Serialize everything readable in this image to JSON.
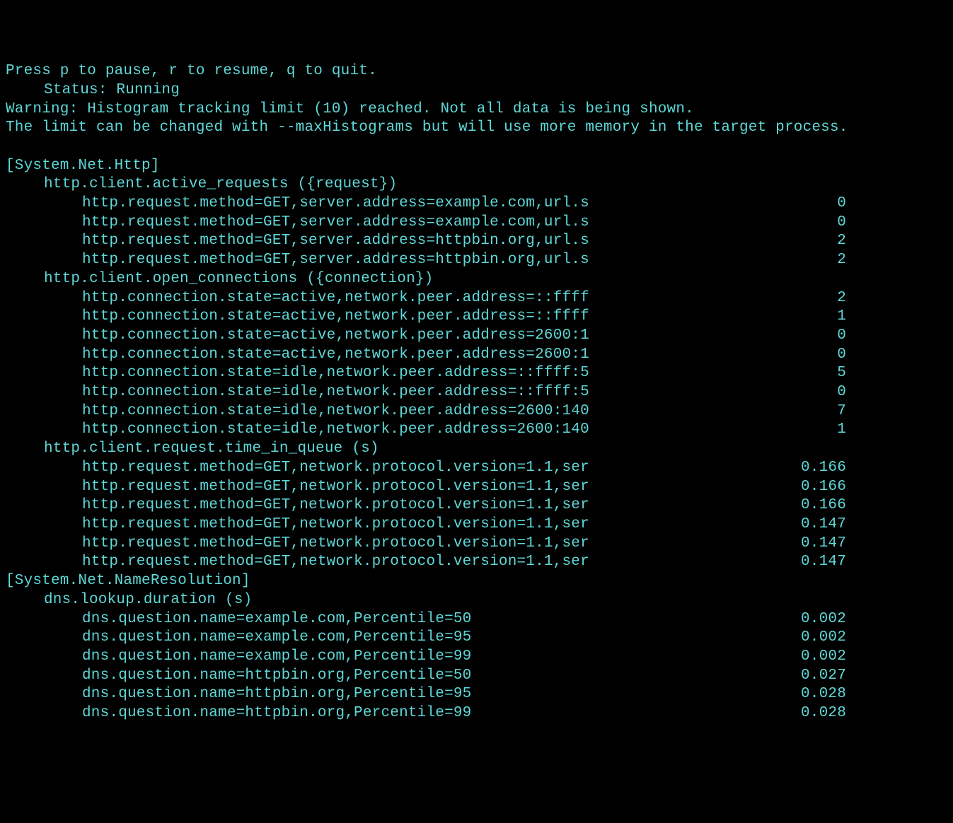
{
  "header": {
    "controls": "Press p to pause, r to resume, q to quit.",
    "status_label": "Status:",
    "status_value": "Running",
    "warning_line1": "Warning: Histogram tracking limit (10) reached. Not all data is being shown.",
    "warning_line2": "The limit can be changed with --maxHistograms but will use more memory in the target process."
  },
  "sections": [
    {
      "name": "[System.Net.Http]",
      "metrics": [
        {
          "title": "http.client.active_requests ({request})",
          "rows": [
            {
              "label": "http.request.method=GET,server.address=example.com,url.s",
              "value": "0"
            },
            {
              "label": "http.request.method=GET,server.address=example.com,url.s",
              "value": "0"
            },
            {
              "label": "http.request.method=GET,server.address=httpbin.org,url.s",
              "value": "2"
            },
            {
              "label": "http.request.method=GET,server.address=httpbin.org,url.s",
              "value": "2"
            }
          ]
        },
        {
          "title": "http.client.open_connections ({connection})",
          "rows": [
            {
              "label": "http.connection.state=active,network.peer.address=::ffff",
              "value": "2"
            },
            {
              "label": "http.connection.state=active,network.peer.address=::ffff",
              "value": "1"
            },
            {
              "label": "http.connection.state=active,network.peer.address=2600:1",
              "value": "0"
            },
            {
              "label": "http.connection.state=active,network.peer.address=2600:1",
              "value": "0"
            },
            {
              "label": "http.connection.state=idle,network.peer.address=::ffff:5",
              "value": "5"
            },
            {
              "label": "http.connection.state=idle,network.peer.address=::ffff:5",
              "value": "0"
            },
            {
              "label": "http.connection.state=idle,network.peer.address=2600:140",
              "value": "7"
            },
            {
              "label": "http.connection.state=idle,network.peer.address=2600:140",
              "value": "1"
            }
          ]
        },
        {
          "title": "http.client.request.time_in_queue (s)",
          "rows": [
            {
              "label": "http.request.method=GET,network.protocol.version=1.1,ser",
              "value": "0.166"
            },
            {
              "label": "http.request.method=GET,network.protocol.version=1.1,ser",
              "value": "0.166"
            },
            {
              "label": "http.request.method=GET,network.protocol.version=1.1,ser",
              "value": "0.166"
            },
            {
              "label": "http.request.method=GET,network.protocol.version=1.1,ser",
              "value": "0.147"
            },
            {
              "label": "http.request.method=GET,network.protocol.version=1.1,ser",
              "value": "0.147"
            },
            {
              "label": "http.request.method=GET,network.protocol.version=1.1,ser",
              "value": "0.147"
            }
          ]
        }
      ]
    },
    {
      "name": "[System.Net.NameResolution]",
      "metrics": [
        {
          "title": "dns.lookup.duration (s)",
          "rows": [
            {
              "label": "dns.question.name=example.com,Percentile=50",
              "value": "0.002"
            },
            {
              "label": "dns.question.name=example.com,Percentile=95",
              "value": "0.002"
            },
            {
              "label": "dns.question.name=example.com,Percentile=99",
              "value": "0.002"
            },
            {
              "label": "dns.question.name=httpbin.org,Percentile=50",
              "value": "0.027"
            },
            {
              "label": "dns.question.name=httpbin.org,Percentile=95",
              "value": "0.028"
            },
            {
              "label": "dns.question.name=httpbin.org,Percentile=99",
              "value": "0.028"
            }
          ]
        }
      ]
    }
  ]
}
